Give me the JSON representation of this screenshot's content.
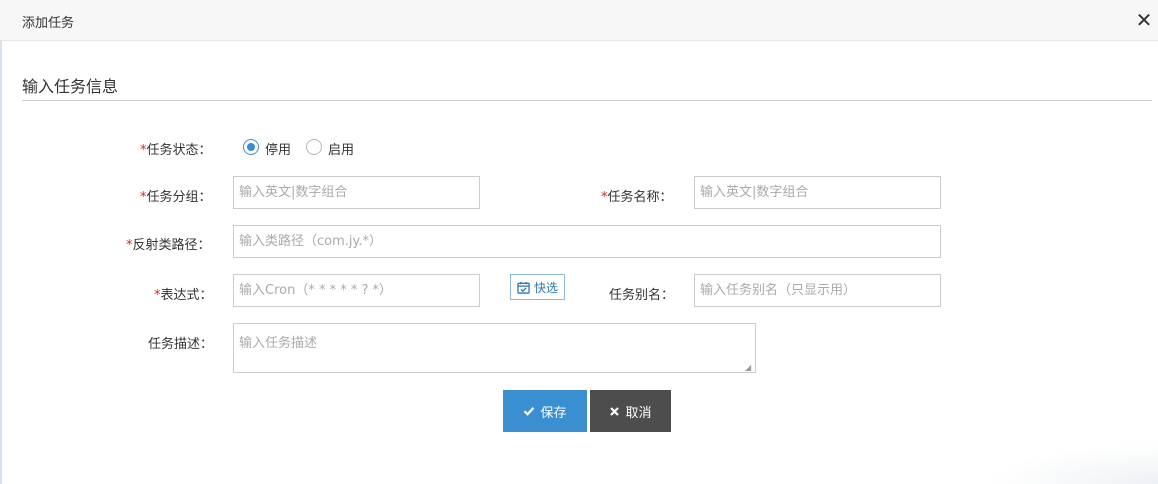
{
  "modal": {
    "title": "添加任务",
    "close_glyph": "✕"
  },
  "section": {
    "title": "输入任务信息"
  },
  "form": {
    "required_mark": "*",
    "status": {
      "label": "任务状态：",
      "options": [
        {
          "label": "停用",
          "checked": true
        },
        {
          "label": "启用",
          "checked": false
        }
      ]
    },
    "group": {
      "label": "任务分组：",
      "value": "",
      "placeholder": "输入英文|数字组合"
    },
    "name": {
      "label": "任务名称：",
      "value": "",
      "placeholder": "输入英文|数字组合"
    },
    "class_path": {
      "label": "反射类路径：",
      "value": "",
      "placeholder": "输入类路径（com.jy.*）"
    },
    "cron": {
      "label": "表达式：",
      "value": "",
      "placeholder": "输入Cron（* * * * * ? *）",
      "quick_select_label": "快选",
      "quick_select_icon": "calendar-check-icon"
    },
    "alias": {
      "label": "任务别名：",
      "value": "",
      "placeholder": "输入任务别名（只显示用）"
    },
    "description": {
      "label": "任务描述：",
      "value": "",
      "placeholder": "输入任务描述"
    }
  },
  "actions": {
    "save_label": "保存",
    "save_icon": "check-icon",
    "cancel_label": "取消",
    "cancel_icon": "times-icon"
  },
  "colors": {
    "accent": "#3a8fd1",
    "required": "#e02020",
    "cancel_bg": "#4d4d4d"
  }
}
